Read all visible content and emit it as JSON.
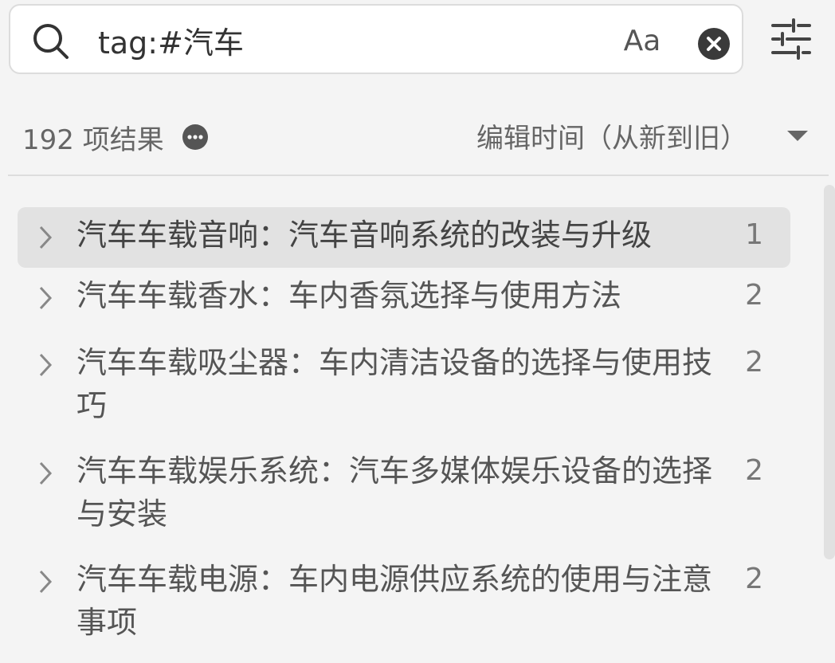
{
  "search": {
    "value": "tag:#汽车",
    "match_case_label": "Aa",
    "icon": "search-icon",
    "clear_icon": "close-circle-icon",
    "filter_icon": "sliders-icon"
  },
  "results_bar": {
    "count_text": "192 项结果",
    "more_icon": "more-horizontal-icon",
    "sort_label": "编辑时间（从新到旧）",
    "sort_icon": "caret-down-icon"
  },
  "results": [
    {
      "title": "汽车车载音响：汽车音响系统的改装与升级",
      "count": "1",
      "selected": true
    },
    {
      "title": "汽车车载香水：车内香氛选择与使用方法",
      "count": "2",
      "selected": false
    },
    {
      "title": "汽车车载吸尘器：车内清洁设备的选择与使用技巧",
      "count": "2",
      "selected": false
    },
    {
      "title": "汽车车载娱乐系统：汽车多媒体娱乐设备的选择与安装",
      "count": "2",
      "selected": false
    },
    {
      "title": "汽车车载电源：车内电源供应系统的使用与注意事项",
      "count": "2",
      "selected": false
    }
  ],
  "colors": {
    "background": "#f4f4f4",
    "selected_row": "#e2e2e2",
    "text": "#555555"
  }
}
